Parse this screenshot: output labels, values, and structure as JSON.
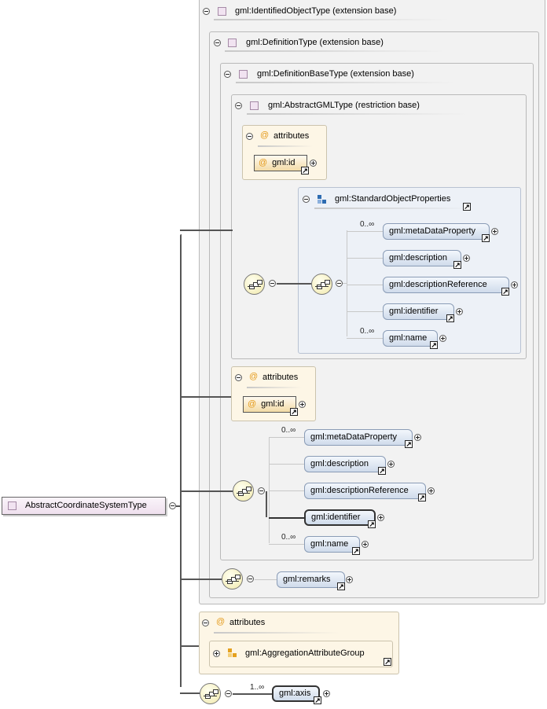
{
  "root": {
    "label": "AbstractCoordinateSystemType"
  },
  "extensions": {
    "identified": "gml:IdentifiedObjectType (extension base)",
    "definition": "gml:DefinitionType (extension base)",
    "definition_base": "gml:DefinitionBaseType (extension base)",
    "abstract_gml": "gml:AbstractGMLType (restriction base)"
  },
  "attributes_label": "attributes",
  "at_symbol": "@",
  "inner_attr": {
    "id_label": "gml:id"
  },
  "group": {
    "title": "gml:StandardObjectProperties"
  },
  "inner_seq": [
    {
      "card": "0..∞",
      "label": "gml:metaDataProperty"
    },
    {
      "card": "",
      "label": "gml:description"
    },
    {
      "card": "",
      "label": "gml:descriptionReference"
    },
    {
      "card": "",
      "label": "gml:identifier"
    },
    {
      "card": "0..∞",
      "label": "gml:name"
    }
  ],
  "def_attr": {
    "id_label": "gml:id"
  },
  "def_seq": [
    {
      "card": "0..∞",
      "label": "gml:metaDataProperty"
    },
    {
      "card": "",
      "label": "gml:description"
    },
    {
      "card": "",
      "label": "gml:descriptionReference"
    },
    {
      "card": "",
      "label": "gml:identifier"
    },
    {
      "card": "0..∞",
      "label": "gml:name"
    }
  ],
  "remarks": {
    "label": "gml:remarks"
  },
  "aggregation": {
    "label": "gml:AggregationAttributeGroup"
  },
  "axis": {
    "card": "1..∞",
    "label": "gml:axis"
  },
  "ref_glyph": "↗"
}
